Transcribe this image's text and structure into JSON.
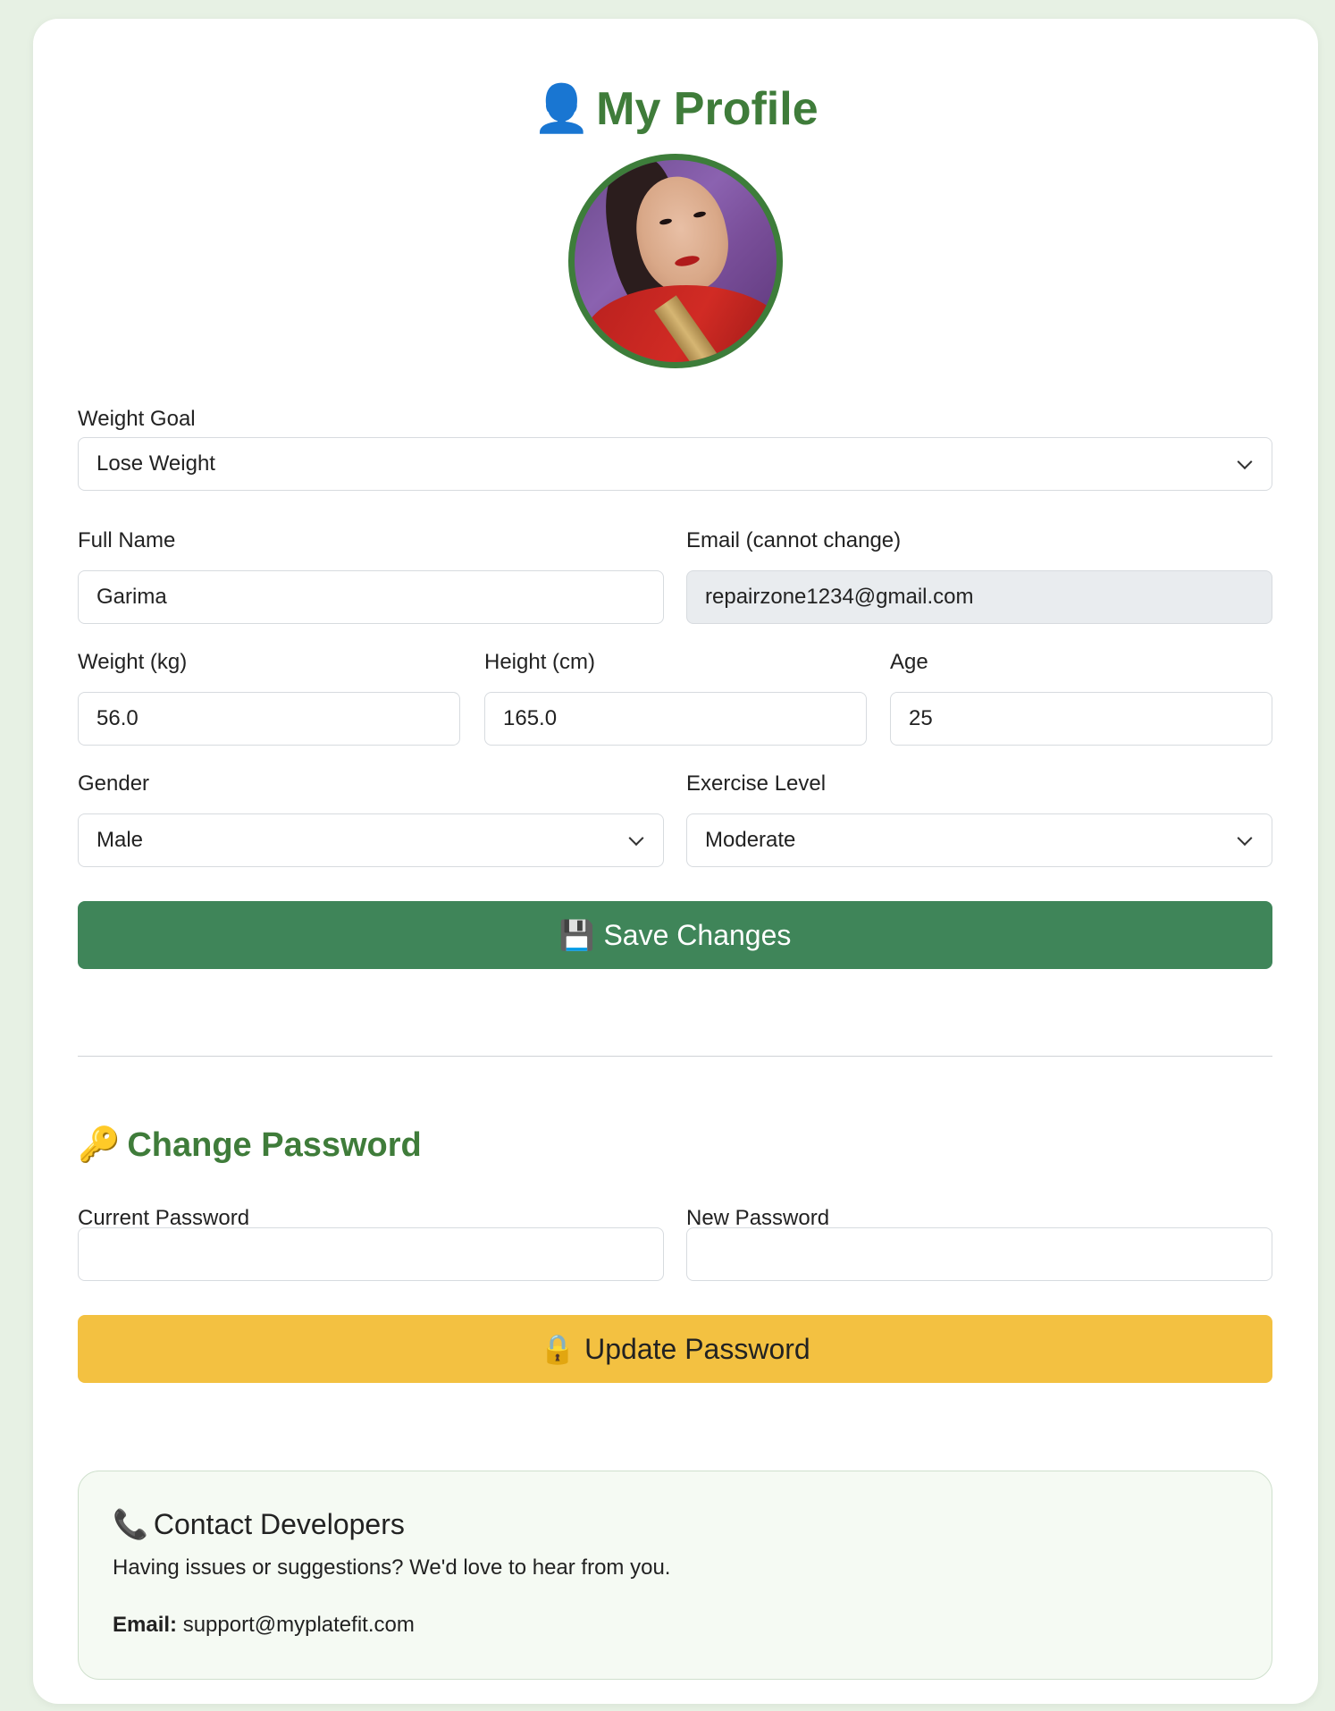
{
  "header": {
    "icon": "👤",
    "icon_name": "user-silhouette-icon",
    "title": "My Profile"
  },
  "profile": {
    "avatar_alt": "Profile photo"
  },
  "form": {
    "weight_goal": {
      "label": "Weight Goal",
      "value": "Lose Weight"
    },
    "full_name": {
      "label": "Full Name",
      "value": "Garima"
    },
    "email": {
      "label": "Email (cannot change)",
      "value": "repairzone1234@gmail.com"
    },
    "weight": {
      "label": "Weight (kg)",
      "value": "56.0"
    },
    "height": {
      "label": "Height (cm)",
      "value": "165.0"
    },
    "age": {
      "label": "Age",
      "value": "25"
    },
    "gender": {
      "label": "Gender",
      "value": "Male"
    },
    "exercise_level": {
      "label": "Exercise Level",
      "value": "Moderate"
    },
    "save_button": {
      "icon": "💾",
      "icon_name": "floppy-disk-icon",
      "label": "Save Changes"
    }
  },
  "password": {
    "icon": "🔑",
    "icon_name": "key-icon",
    "title": "Change Password",
    "current": {
      "label": "Current Password",
      "value": ""
    },
    "new": {
      "label": "New Password",
      "value": ""
    },
    "update_button": {
      "icon": "🔒",
      "icon_name": "lock-icon",
      "label": "Update Password"
    }
  },
  "contact": {
    "icon": "📞",
    "icon_name": "telephone-icon",
    "title": "Contact Developers",
    "text": "Having issues or suggestions? We'd love to hear from you.",
    "email_label": "Email:",
    "email_value": "support@myplatefit.com"
  },
  "colors": {
    "background": "#e7f1e4",
    "heading_green": "#3f7c3a",
    "save_button": "#3f8559",
    "password_button": "#f3c141",
    "contact_bg": "#f5faf3"
  }
}
